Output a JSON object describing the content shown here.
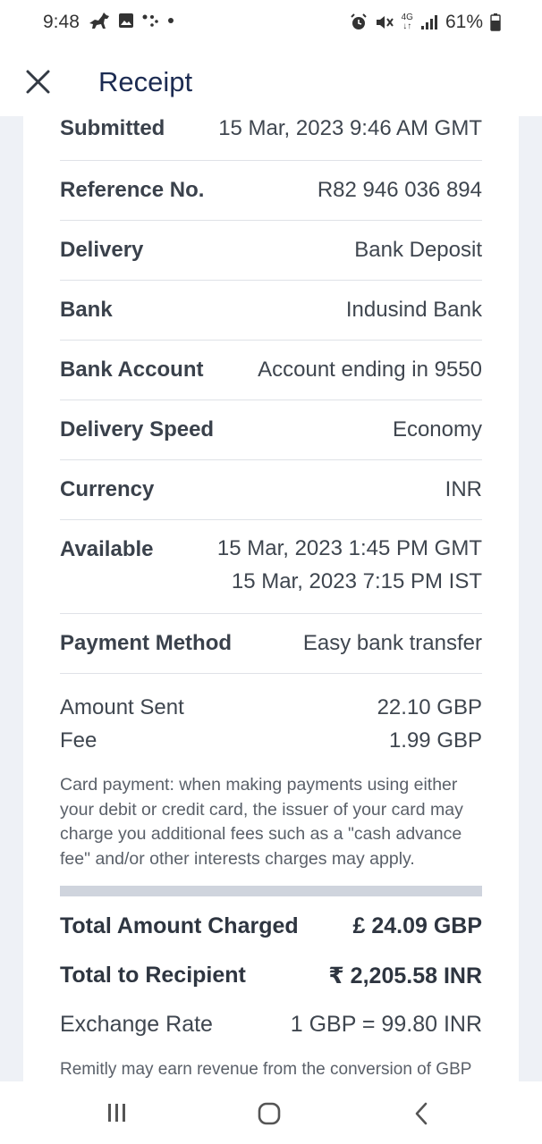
{
  "status_bar": {
    "time": "9:48",
    "battery": "61%",
    "network": "4G",
    "icons": [
      "horse-icon",
      "image-icon",
      "dots-icon",
      "alarm-icon",
      "mute-icon",
      "network-4g-icon",
      "signal-icon",
      "battery-icon"
    ]
  },
  "header": {
    "title": "Receipt",
    "close_icon": "close-icon"
  },
  "details": [
    {
      "label": "Submitted",
      "value": [
        "15 Mar, 2023 9:46 AM GMT"
      ]
    },
    {
      "label": "Reference No.",
      "value": [
        "R82 946 036 894"
      ]
    },
    {
      "label": "Delivery",
      "value": [
        "Bank Deposit"
      ]
    },
    {
      "label": "Bank",
      "value": [
        "Indusind Bank"
      ]
    },
    {
      "label": "Bank Account",
      "value": [
        "Account ending in 9550"
      ]
    },
    {
      "label": "Delivery Speed",
      "value": [
        "Economy"
      ]
    },
    {
      "label": "Currency",
      "value": [
        "INR"
      ]
    },
    {
      "label": "Available",
      "value": [
        "15 Mar, 2023 1:45 PM GMT",
        "15 Mar, 2023 7:15 PM IST"
      ]
    },
    {
      "label": "Payment Method",
      "value": [
        "Easy bank transfer"
      ]
    }
  ],
  "amounts": {
    "sent_label": "Amount Sent",
    "sent_value": "22.10 GBP",
    "fee_label": "Fee",
    "fee_value": "1.99 GBP"
  },
  "fee_note": "Card payment: when making payments using either your debit or credit card, the issuer of your card may charge you additional fees such as a \"cash advance fee\" and/or other interests charges may apply.",
  "totals": {
    "charged_label": "Total Amount Charged",
    "charged_value": "£ 24.09 GBP",
    "recipient_label": "Total to Recipient",
    "recipient_value": "₹ 2,205.58 INR",
    "rate_label": "Exchange Rate",
    "rate_value": "1 GBP = 99.80 INR"
  },
  "revenue_note": "Remitly may earn revenue from the conversion of GBP",
  "nav_bar": {
    "icons": [
      "recent-apps-icon",
      "home-icon",
      "back-icon"
    ]
  },
  "colors": {
    "title": "#1c2b52",
    "background": "#eef1f6",
    "divider": "#cfd4dd"
  }
}
